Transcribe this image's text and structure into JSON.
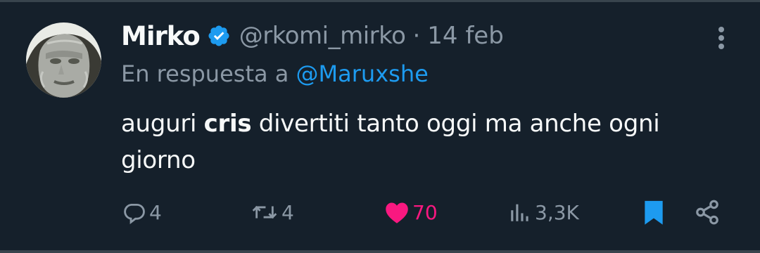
{
  "tweet": {
    "author": {
      "display_name": "Mirko",
      "handle": "@rkomi_mirko",
      "verified": true
    },
    "separator": "·",
    "date": "14 feb",
    "reply_prefix": "En respuesta a",
    "reply_to": "@Maruxshe",
    "text": {
      "part1": "auguri ",
      "bold": "cris",
      "part2": " divertiti tanto oggi ma anche ogni giorno"
    }
  },
  "actions": {
    "replies": "4",
    "retweets": "4",
    "likes": "70",
    "views": "3,3K"
  },
  "icons": {
    "verified": "verified-badge-icon",
    "more": "more-vertical-icon",
    "reply": "reply-icon",
    "retweet": "retweet-icon",
    "like": "heart-filled-icon",
    "views": "views-chart-icon",
    "bookmark": "bookmark-filled-icon",
    "share": "share-icon"
  },
  "colors": {
    "background": "#15202b",
    "text": "#f7f9f9",
    "secondary": "#8b98a5",
    "accent": "#1d9bf0",
    "like": "#f91880"
  }
}
